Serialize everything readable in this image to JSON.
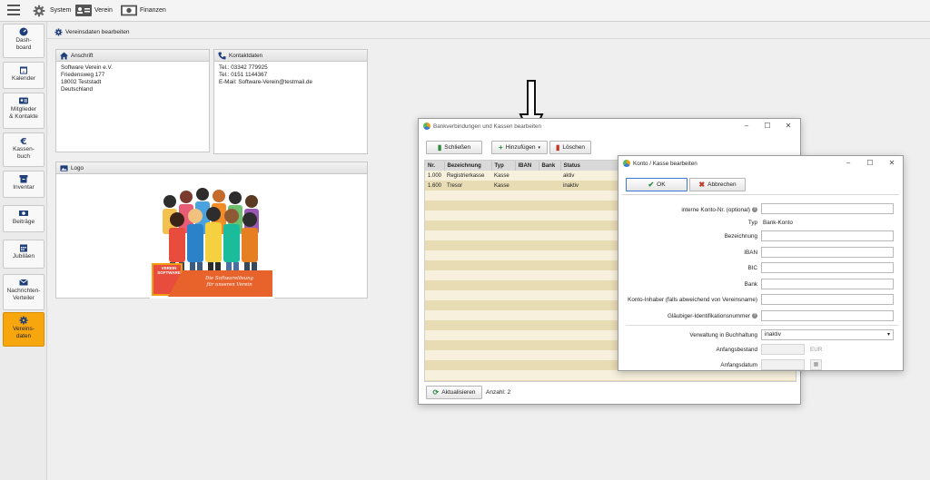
{
  "topbar": {
    "system_label": "System",
    "verein_label": "Verein",
    "finanzen_label": "Finanzen"
  },
  "sidebar": {
    "items": [
      {
        "label": "Dash-\nboard",
        "icon": "speedometer-icon"
      },
      {
        "label": "Kalender",
        "icon": "calendar-icon"
      },
      {
        "label": "Mitglieder\n& Kontakte",
        "icon": "id-card-icon"
      },
      {
        "label": "Kassen-\nbuch",
        "icon": "euro-icon"
      },
      {
        "label": "Inventar",
        "icon": "box-icon"
      },
      {
        "label": "Beiträge",
        "icon": "money-icon"
      },
      {
        "label": "Jubiläen",
        "icon": "calendar-grid-icon"
      },
      {
        "label": "Nachrichten-\nVerteiler",
        "icon": "mail-icon"
      },
      {
        "label": "Vereins-\ndaten",
        "icon": "gear-icon"
      }
    ]
  },
  "breadcrumb": "Vereinsdaten bearbeiten",
  "anschrift": {
    "title": "Anschrift",
    "lines": [
      "Software Verein  e.V.",
      "Friedensweg 177",
      "18002 Teststadt",
      "Deutschland"
    ]
  },
  "kontakt": {
    "title": "Kontaktdaten",
    "lines": [
      "Tel.: 03342 779925",
      "Tel.: 0151 1144367",
      "E-Mail: Software-Verein@testmail.de"
    ]
  },
  "logo": {
    "title": "Logo",
    "banner_brand": "VEREIN\nSOFTWARE",
    "banner_text": "Die Softwarelösung\nfür unseren Verein"
  },
  "bank_dialog": {
    "title": "Bankverbindungen und Kassen bearbeiten",
    "btn_close": "Schließen",
    "btn_add": "Hinzufügen",
    "btn_delete": "Löschen",
    "columns": [
      "Nr.",
      "Bezeichnung",
      "Typ",
      "IBAN",
      "Bank",
      "Status"
    ],
    "rows": [
      [
        "1.000",
        "Registrierkasse",
        "Kasse",
        "",
        "",
        "aktiv"
      ],
      [
        "1.600",
        "Tresor",
        "Kasse",
        "",
        "",
        "inaktiv"
      ]
    ],
    "btn_refresh": "Aktualisieren",
    "count": "Anzahl: 2"
  },
  "konto_dialog": {
    "title": "Konto / Kasse bearbeiten",
    "btn_ok": "OK",
    "btn_cancel": "Abbrechen",
    "fields": {
      "intern_label": "interne Konto-Nr. (optional)",
      "typ_label": "Typ",
      "typ_value": "Bank-Konto",
      "bezeichnung_label": "Bezeichnung",
      "iban_label": "IBAN",
      "bic_label": "BIC",
      "bank_label": "Bank",
      "inhaber_label": "Konto-Inhaber (falls abweichend von Vereinsname)",
      "glaeubiger_label": "Gläubiger-Identifikationsnummer",
      "verwaltung_label": "Verwaltung in Buchhaltung",
      "verwaltung_value": "inaktiv",
      "anfangsbestand_label": "Anfangsbestand",
      "currency": "EUR",
      "anfangsdatum_label": "Anfangsdatum"
    }
  },
  "colors": {
    "active_sidebar": "#f7a60e",
    "row_light": "#f7f0dc",
    "row_dark": "#e8dcb5"
  }
}
